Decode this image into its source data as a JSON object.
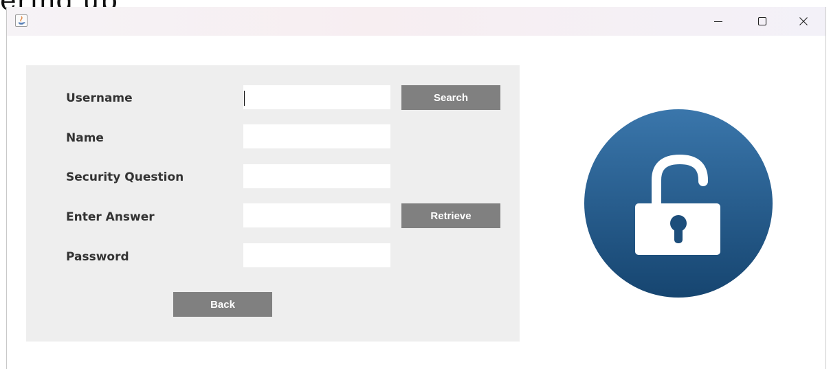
{
  "background_text": "ering up",
  "window": {
    "app_icon": "java-icon",
    "minimize_glyph": "—",
    "controls": [
      "minimize-icon",
      "maximize-icon",
      "close-icon"
    ]
  },
  "form": {
    "labels": {
      "username": "Username",
      "name": "Name",
      "security_question": "Security Question",
      "enter_answer": "Enter Answer",
      "password": "Password"
    },
    "values": {
      "username": "",
      "name": "",
      "security_question": "",
      "enter_answer": "",
      "password": ""
    },
    "buttons": {
      "search": "Search",
      "retrieve": "Retrieve",
      "back": "Back"
    }
  },
  "illustration": {
    "icon": "unlocked-padlock-icon",
    "colors": {
      "circle_top": "#3a76ab",
      "circle_bottom": "#164570",
      "lock": "#ffffff"
    }
  },
  "colors": {
    "panel": "#eeeeee",
    "button": "#808080",
    "label": "#333333"
  }
}
